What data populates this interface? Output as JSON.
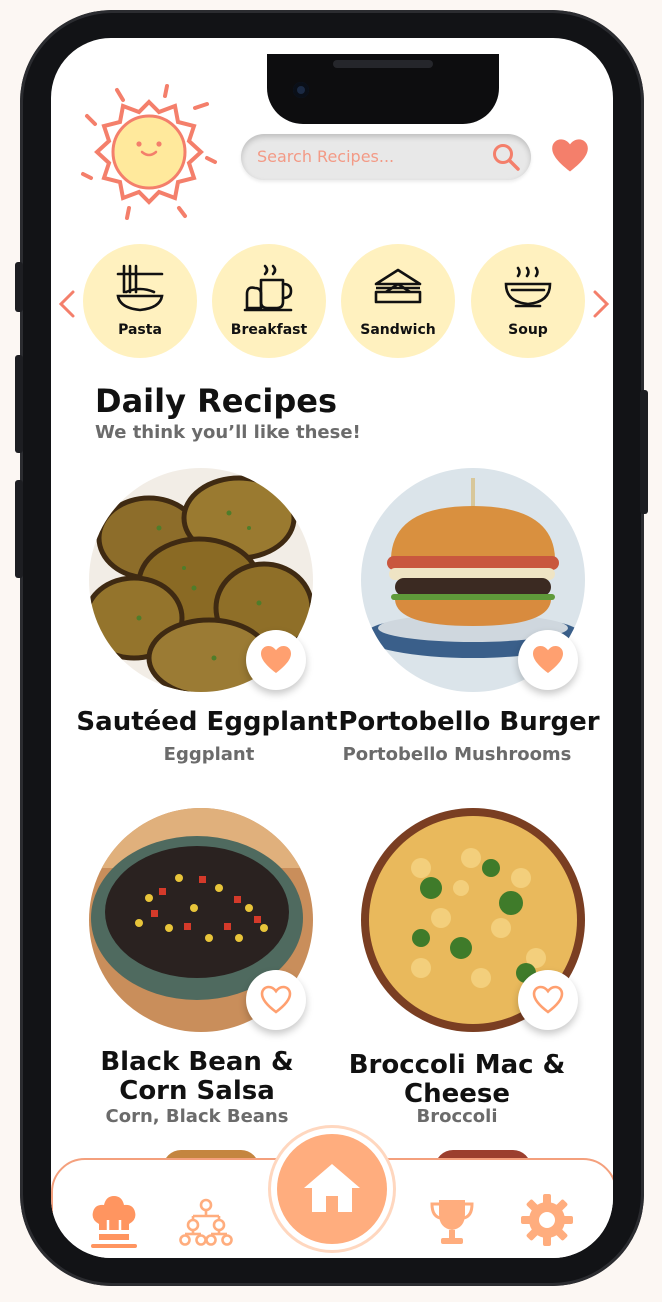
{
  "header": {
    "search_placeholder": "Search Recipes...",
    "icons": {
      "logo": "sun-logo",
      "search": "search-icon",
      "favorites": "heart-icon"
    }
  },
  "categories": [
    {
      "label": "Pasta",
      "icon": "pasta-icon"
    },
    {
      "label": "Breakfast",
      "icon": "breakfast-icon"
    },
    {
      "label": "Sandwich",
      "icon": "sandwich-icon"
    },
    {
      "label": "Soup",
      "icon": "soup-icon"
    }
  ],
  "daily": {
    "title": "Daily Recipes",
    "subtitle": "We think you’ll like these!"
  },
  "recipes": [
    {
      "name": "Sautéed Eggplant",
      "ingredients": "Eggplant",
      "favorited": true
    },
    {
      "name": "Portobello Burger",
      "ingredients": "Portobello Mushrooms",
      "favorited": true
    },
    {
      "name_line1": "Black Bean &",
      "name_line2": "Corn Salsa",
      "ingredients": "Corn, Black Beans",
      "favorited": false
    },
    {
      "name_line1": "Broccoli Mac &",
      "name_line2": "Cheese",
      "ingredients": "Broccoli",
      "favorited": false
    }
  ],
  "nav": {
    "items": [
      "chef-hat-icon",
      "tree-icon",
      "home-icon",
      "trophy-icon",
      "gear-icon"
    ],
    "active": "chef-hat-icon"
  },
  "colors": {
    "accent": "#f47f6b",
    "orange": "#ffad7e",
    "category_bg": "#fff1bf",
    "nav_border": "#f4a07d"
  }
}
